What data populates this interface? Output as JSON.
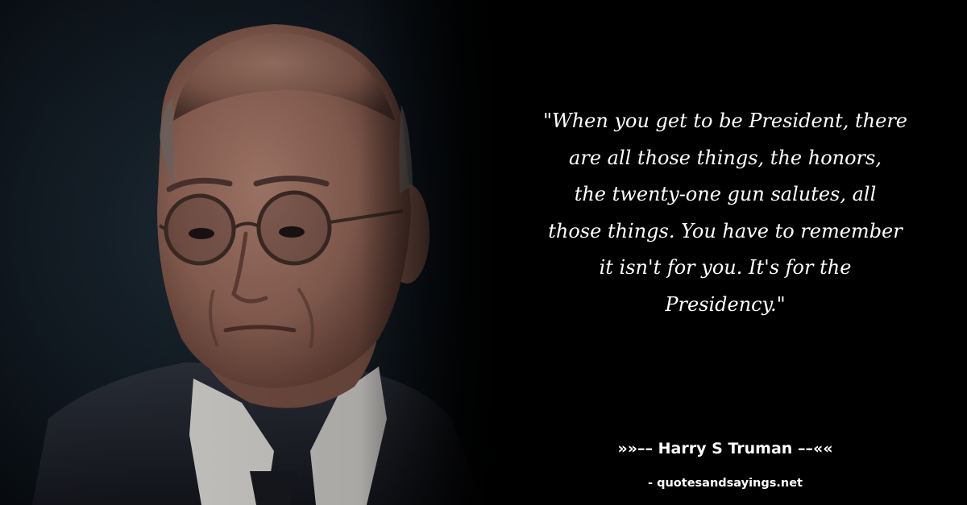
{
  "quote": {
    "lines": [
      "\"When you get to be President, there",
      "are all those things, the honors,",
      "the twenty-one gun salutes, all",
      "those things. You have to remember",
      "it isn't for you. It's for the",
      "Presidency.\""
    ]
  },
  "attribution": {
    "author_line": "»»–– Harry S Truman ––««",
    "source": "- quotesandsayings.net"
  },
  "colors": {
    "background": "#000000",
    "text": "#ffffff",
    "suit": "#1b1e26",
    "skin": "#8c6458"
  },
  "image": {
    "subject": "portrait-photo"
  }
}
